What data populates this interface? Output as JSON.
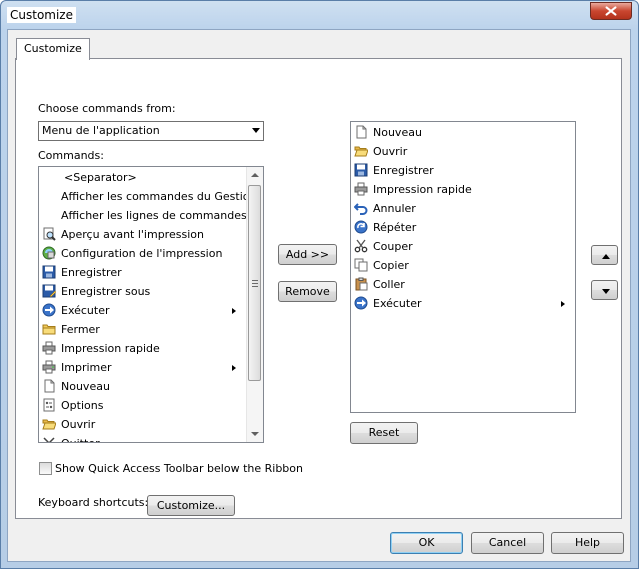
{
  "window": {
    "title": "Customize"
  },
  "tabs": [
    {
      "label": "Customize"
    }
  ],
  "choose": {
    "label": "Choose commands from:",
    "value": "Menu de l'application"
  },
  "commands": {
    "label": "Commands:",
    "items": [
      {
        "label": "<Separator>",
        "icon": "none",
        "submenu": false
      },
      {
        "label": "Afficher les commandes du Gestionnai",
        "icon": "none",
        "submenu": false
      },
      {
        "label": "Afficher les lignes de commandes",
        "icon": "none",
        "submenu": false
      },
      {
        "label": "Aperçu avant l'impression",
        "icon": "print-preview-icon",
        "submenu": false
      },
      {
        "label": "Configuration de l'impression",
        "icon": "page-setup-icon",
        "submenu": false
      },
      {
        "label": "Enregistrer",
        "icon": "save-icon",
        "submenu": false
      },
      {
        "label": "Enregistrer sous",
        "icon": "save-as-icon",
        "submenu": false
      },
      {
        "label": "Exécuter",
        "icon": "run-icon",
        "submenu": true
      },
      {
        "label": "Fermer",
        "icon": "close-folder-icon",
        "submenu": false
      },
      {
        "label": "Impression rapide",
        "icon": "quick-print-icon",
        "submenu": false
      },
      {
        "label": "Imprimer",
        "icon": "print-icon",
        "submenu": true
      },
      {
        "label": "Nouveau",
        "icon": "new-document-icon",
        "submenu": false
      },
      {
        "label": "Options",
        "icon": "options-icon",
        "submenu": false
      },
      {
        "label": "Ouvrir",
        "icon": "open-folder-icon",
        "submenu": false
      },
      {
        "label": "Quitter",
        "icon": "exit-icon",
        "submenu": false
      }
    ]
  },
  "toolbar_items": [
    {
      "label": "Nouveau",
      "icon": "new-document-icon",
      "submenu": false
    },
    {
      "label": "Ouvrir",
      "icon": "open-folder-icon",
      "submenu": false
    },
    {
      "label": "Enregistrer",
      "icon": "save-icon",
      "submenu": false
    },
    {
      "label": "Impression rapide",
      "icon": "quick-print-icon",
      "submenu": false
    },
    {
      "label": "Annuler",
      "icon": "undo-icon",
      "submenu": false
    },
    {
      "label": "Répéter",
      "icon": "redo-icon",
      "submenu": false
    },
    {
      "label": "Couper",
      "icon": "cut-icon",
      "submenu": false
    },
    {
      "label": "Copier",
      "icon": "copy-icon",
      "submenu": false
    },
    {
      "label": "Coller",
      "icon": "paste-icon",
      "submenu": false
    },
    {
      "label": "Exécuter",
      "icon": "run-icon",
      "submenu": true
    }
  ],
  "buttons": {
    "add": "Add >>",
    "remove": "Remove",
    "reset": "Reset",
    "customize": "Customize...",
    "ok": "OK",
    "cancel": "Cancel",
    "help": "Help"
  },
  "qat_checkbox": {
    "label": "Show Quick Access Toolbar below the Ribbon",
    "checked": false
  },
  "keyboard": {
    "label": "Keyboard shortcuts:"
  },
  "colors": {
    "selection": "#3399ff",
    "window_frame": "#b9d1ea",
    "close_button": "#c9462f"
  }
}
